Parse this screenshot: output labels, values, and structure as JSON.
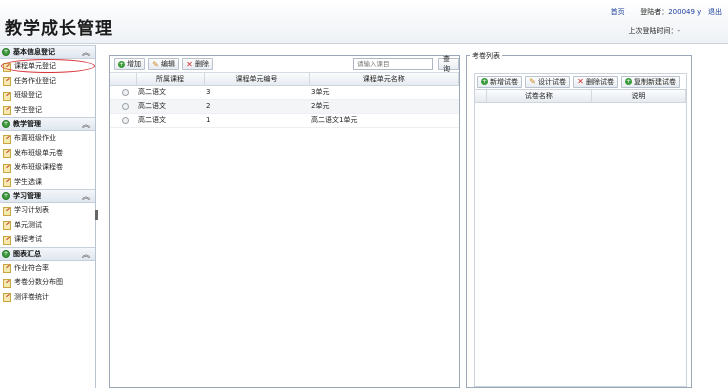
{
  "header": {
    "title": "教学成长管理",
    "home_link": "首页",
    "login_user_label": "登陆者：",
    "login_user": "200049 y",
    "logout_link": "退出",
    "last_login_label": "上次登陆时间：",
    "last_login_value": "-"
  },
  "sidebar": {
    "sections": [
      {
        "title": "基本信息登记",
        "items": [
          "课程单元登记",
          "任务作业登记",
          "班级登记",
          "学生登记"
        ]
      },
      {
        "title": "教学管理",
        "items": [
          "布置班级作业",
          "发布班级单元卷",
          "发布班级课程卷",
          "学生选课"
        ]
      },
      {
        "title": "学习管理",
        "items": [
          "学习计划表",
          "单元测试",
          "课程考试"
        ]
      },
      {
        "title": "图表汇总",
        "items": [
          "作业符合率",
          "考卷分数分布图",
          "测评卷统计"
        ]
      }
    ],
    "active_item": "课程单元登记"
  },
  "center": {
    "toolbar": {
      "add": "增加",
      "edit": "编辑",
      "delete": "删除"
    },
    "search": {
      "placeholder": "请输入课目",
      "button": "查询"
    },
    "columns": [
      "所属课程",
      "课程单元编号",
      "课程单元名称"
    ],
    "rows": [
      {
        "course": "高二语文",
        "unit_no": "3",
        "unit_name": "3单元"
      },
      {
        "course": "高二语文",
        "unit_no": "2",
        "unit_name": "2单元"
      },
      {
        "course": "高二语文",
        "unit_no": "1",
        "unit_name": "高二语文1单元"
      }
    ]
  },
  "right": {
    "caption": "考卷列表",
    "toolbar": {
      "add": "新增试卷",
      "design": "设计试卷",
      "delete": "删除试卷",
      "copy": "复制新建试卷"
    },
    "columns": [
      "试卷名称",
      "说明"
    ]
  },
  "colors": {
    "accent_green": "#3a9a3a",
    "link_blue": "#1a3c9c",
    "active_ring": "#d9363a"
  },
  "icons": {
    "section": "green-plus-circle-icon",
    "nav": "edit-document-icon",
    "collapse": "double-chevron-up-icon"
  }
}
